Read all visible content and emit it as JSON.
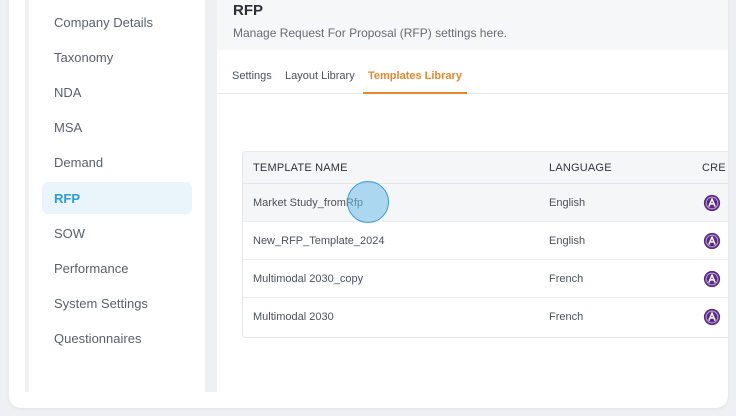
{
  "sidebar": {
    "items": [
      {
        "label": "Company Details",
        "active": false
      },
      {
        "label": "Taxonomy",
        "active": false
      },
      {
        "label": "NDA",
        "active": false
      },
      {
        "label": "MSA",
        "active": false
      },
      {
        "label": "Demand",
        "active": false
      },
      {
        "label": "RFP",
        "active": true
      },
      {
        "label": "SOW",
        "active": false
      },
      {
        "label": "Performance",
        "active": false
      },
      {
        "label": "System Settings",
        "active": false
      },
      {
        "label": "Questionnaires",
        "active": false
      }
    ]
  },
  "header": {
    "title": "RFP",
    "subtitle": "Manage Request For Proposal (RFP) settings here."
  },
  "tabs": [
    {
      "label": "Settings",
      "active": false
    },
    {
      "label": "Layout Library",
      "active": false
    },
    {
      "label": "Templates Library",
      "active": true
    }
  ],
  "table": {
    "columns": [
      "TEMPLATE NAME",
      "LANGUAGE",
      "CRE"
    ],
    "rows": [
      {
        "name": "Market Study_fromRfp",
        "language": "English"
      },
      {
        "name": "New_RFP_Template_2024",
        "language": "English"
      },
      {
        "name": "Multimodal 2030_copy",
        "language": "French"
      },
      {
        "name": "Multimodal 2030",
        "language": "French"
      }
    ]
  },
  "colors": {
    "accent_blue": "#2f9bd6",
    "accent_orange": "#e6862f",
    "avatar_purple": "#5b2a86"
  },
  "icons": {
    "creator": "avatar-icon"
  }
}
